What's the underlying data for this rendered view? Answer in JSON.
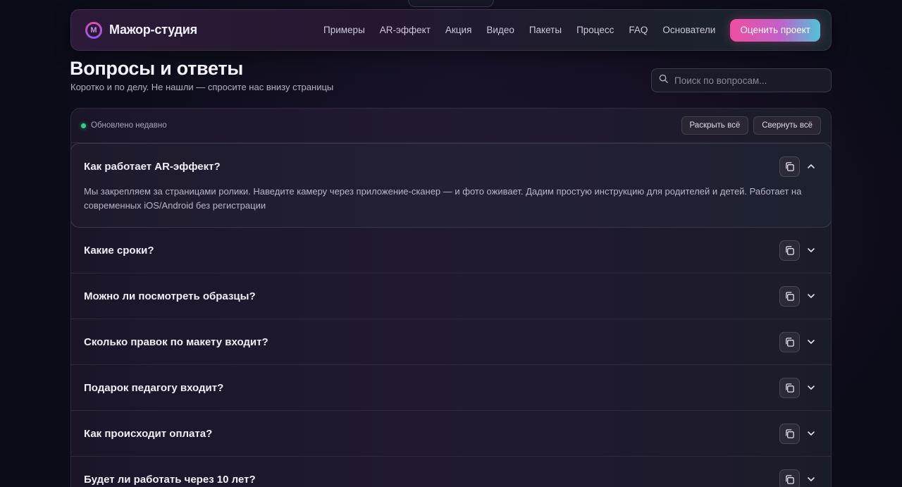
{
  "header": {
    "logo_letter": "M",
    "brand": "Мажор-студия",
    "nav": [
      "Примеры",
      "AR-эффект",
      "Акция",
      "Видео",
      "Пакеты",
      "Процесс",
      "FAQ",
      "Основатели"
    ],
    "cta_label": "Оценить проект",
    "accent_pink": "#ef4fa0",
    "accent_cyan": "#4fc4d8"
  },
  "page": {
    "title": "Вопросы и ответы",
    "subtitle": "Коротко и по делу. Не нашли — спросите нас внизу страницы"
  },
  "search": {
    "placeholder": "Поиск по вопросам...",
    "icon": "search-icon"
  },
  "panel": {
    "status_text": "Обновлено недавно",
    "status_color": "#2fcf8a",
    "expand_all_label": "Раскрыть всё",
    "collapse_all_label": "Свернуть всё"
  },
  "faq": [
    {
      "question": "Как работает AR-эффект?",
      "answer": "Мы закрепляем за страницами ролики. Наведите камеру через приложение-сканер — и фото оживает. Дадим простую инструкцию для родителей и детей. Работает на современных iOS/Android без регистрации",
      "open": true
    },
    {
      "question": "Какие сроки?",
      "open": false
    },
    {
      "question": "Можно ли посмотреть образцы?",
      "open": false
    },
    {
      "question": "Сколько правок по макету входит?",
      "open": false
    },
    {
      "question": "Подарок педагогу входит?",
      "open": false
    },
    {
      "question": "Как происходит оплата?",
      "open": false
    },
    {
      "question": "Будет ли работать через 10 лет?",
      "open": false
    }
  ]
}
